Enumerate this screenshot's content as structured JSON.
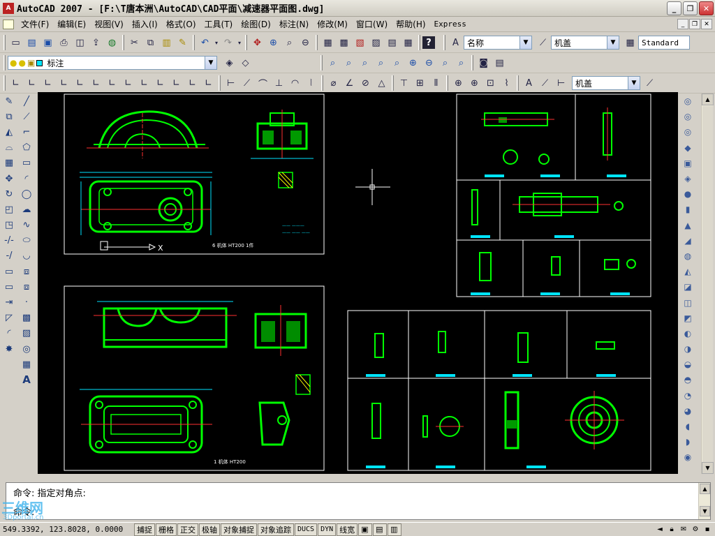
{
  "title": "AutoCAD 2007 - [F:\\T唐本洲\\AutoCAD\\CAD平面\\减速器平面图.dwg]",
  "app_logo": "A",
  "window_controls": [
    "_",
    "❐",
    "✕"
  ],
  "doc_controls": [
    "_",
    "❐",
    "✕"
  ],
  "menu": [
    "文件(F)",
    "编辑(E)",
    "视图(V)",
    "插入(I)",
    "格式(O)",
    "工具(T)",
    "绘图(D)",
    "标注(N)",
    "修改(M)",
    "窗口(W)",
    "帮助(H)"
  ],
  "menu_express": "Express",
  "toolbar1": {
    "textstyle_value": "名称",
    "dimstyle_value": "机盖",
    "tablestyle_value": "Standard"
  },
  "toolbar2": {
    "layer_value": "标注"
  },
  "toolbar3": {
    "dim_style_value": "机盖"
  },
  "command": {
    "history_line": "命令: 指定对角点:",
    "prompt": "命令:"
  },
  "watermark": {
    "text": "三维网",
    "sub": "3Dportal.cn"
  },
  "status": {
    "coordinates": "549.3392, 123.8028, 0.0000",
    "buttons": [
      "捕捉",
      "栅格",
      "正交",
      "极轴",
      "对象捕捉",
      "对象追踪",
      "DUCS",
      "DYN",
      "线宽"
    ]
  },
  "drawing_labels": {
    "sheet1": "6 机体 HT200 1件",
    "sheet2": "1 机体 HT200"
  },
  "colors": {
    "drawing_bg": "#000000",
    "geometry": "#00ff00",
    "border": "#ffffff",
    "dims": "#00e5ff",
    "center": "#ff3030",
    "hatch": "#ffff00"
  },
  "icons": {
    "new": "new-file-icon",
    "open": "open-icon",
    "save": "save-icon",
    "print": "print-icon",
    "undo": "undo-icon",
    "redo": "redo-icon",
    "pan": "pan-icon",
    "zoom": "zoom-icon",
    "help": "help-icon"
  }
}
